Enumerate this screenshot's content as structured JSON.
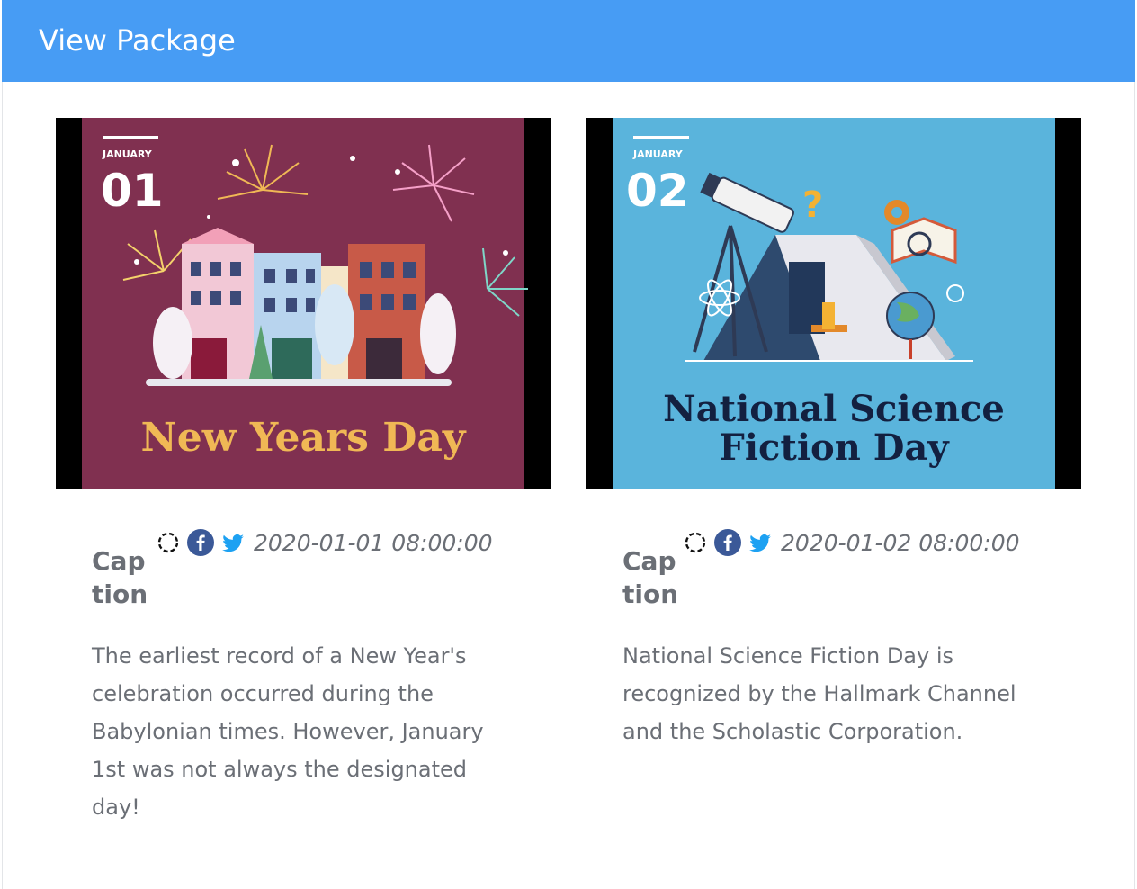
{
  "header": {
    "title": "View Package"
  },
  "posts": [
    {
      "image": {
        "month": "JANUARY",
        "day": "01",
        "title_line1": "New Years Day",
        "title_line2": "",
        "bg_color": "#803050",
        "title_color": "#f0b855"
      },
      "icons": [
        "refresh-icon",
        "facebook-icon",
        "twitter-icon"
      ],
      "date": "2020-01-01 08:00:00",
      "caption_label": "Caption",
      "caption_text": "The earliest record of a New Year's celebration occurred during the Babylonian times. However, January 1st was not always the designated day!"
    },
    {
      "image": {
        "month": "JANUARY",
        "day": "02",
        "title_line1": "National Science",
        "title_line2": "Fiction Day",
        "bg_color": "#5ab4dc",
        "title_color": "#132040"
      },
      "icons": [
        "refresh-icon",
        "facebook-icon",
        "twitter-icon"
      ],
      "date": "2020-01-02 08:00:00",
      "caption_label": "Caption",
      "caption_text": "National Science Fiction Day is recognized by the Hallmark Channel and the Scholastic Corporation."
    }
  ],
  "colors": {
    "header_bg": "#479cf4",
    "text_muted": "#6b6f76",
    "facebook": "#3b5998",
    "twitter": "#1da1f2"
  }
}
